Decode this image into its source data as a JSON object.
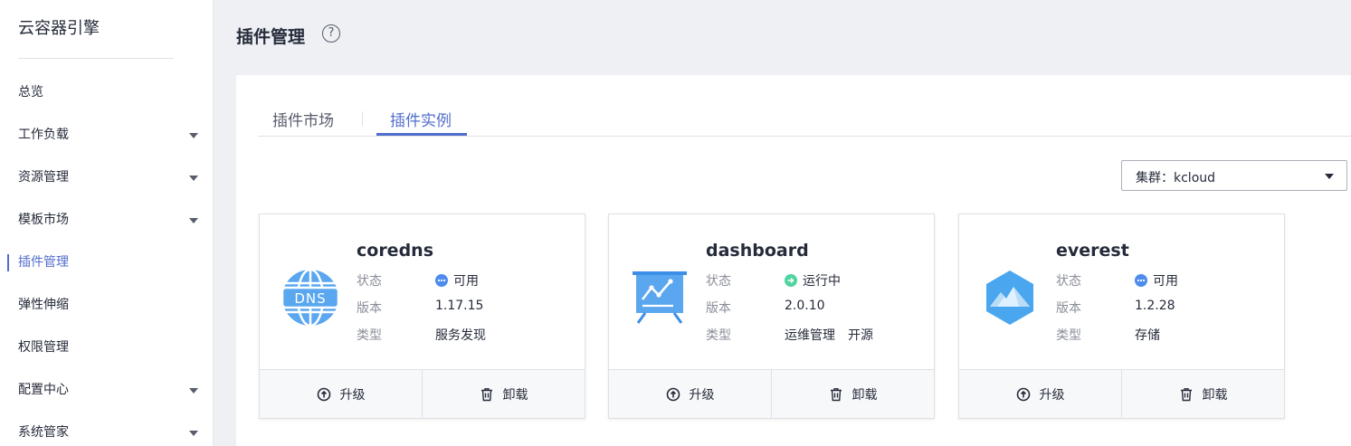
{
  "sidebar": {
    "app_title": "云容器引擎",
    "items": [
      {
        "label": "总览",
        "has_arrow": false
      },
      {
        "label": "工作负载",
        "has_arrow": true
      },
      {
        "label": "资源管理",
        "has_arrow": true
      },
      {
        "label": "模板市场",
        "has_arrow": true
      },
      {
        "label": "插件管理",
        "has_arrow": false,
        "active": true
      },
      {
        "label": "弹性伸缩",
        "has_arrow": false
      },
      {
        "label": "权限管理",
        "has_arrow": false
      },
      {
        "label": "配置中心",
        "has_arrow": true
      },
      {
        "label": "系统管家",
        "has_arrow": true
      }
    ]
  },
  "header": {
    "title": "插件管理",
    "help_icon": "?"
  },
  "tabs": [
    {
      "label": "插件市场",
      "active": false
    },
    {
      "label": "插件实例",
      "active": true
    }
  ],
  "cluster_select": {
    "value": "集群：kcloud"
  },
  "field_labels": {
    "status": "状态",
    "version": "版本",
    "type": "类型"
  },
  "actions": {
    "upgrade": "升级",
    "uninstall": "卸载"
  },
  "cards": [
    {
      "name": "coredns",
      "status": "可用",
      "status_color": "#4e8cee",
      "version": "1.17.15",
      "type": [
        "服务发现"
      ],
      "icon": "dns-globe-icon"
    },
    {
      "name": "dashboard",
      "status": "运行中",
      "status_color": "#50d4a0",
      "version": "2.0.10",
      "type": [
        "运维管理",
        "开源"
      ],
      "icon": "dashboard-chart-icon"
    },
    {
      "name": "everest",
      "status": "可用",
      "status_color": "#4e8cee",
      "version": "1.2.28",
      "type": [
        "存储"
      ],
      "icon": "mountain-hexagon-icon"
    }
  ],
  "colors": {
    "accent": "#526ecc",
    "text": "#252b3a",
    "muted": "#8a8e99"
  }
}
